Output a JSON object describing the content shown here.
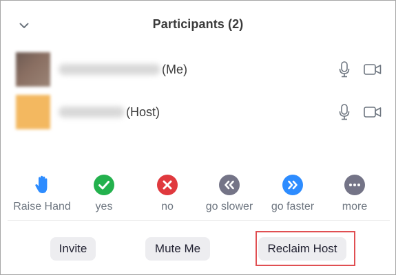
{
  "header": {
    "title": "Participants (2)",
    "collapse_icon": "chevron-down-icon"
  },
  "participants": [
    {
      "role_label": "(Me)",
      "name_hidden": true,
      "mic_icon": "microphone-icon",
      "video_icon": "video-camera-icon"
    },
    {
      "role_label": "(Host)",
      "name_hidden": true,
      "mic_icon": "microphone-icon",
      "video_icon": "video-camera-icon"
    }
  ],
  "reactions": [
    {
      "label": "Raise Hand",
      "icon": "raise-hand-icon",
      "color": "#2d8cff"
    },
    {
      "label": "yes",
      "icon": "checkmark-icon",
      "color": "#23b14d"
    },
    {
      "label": "no",
      "icon": "x-icon",
      "color": "#e0393e"
    },
    {
      "label": "go slower",
      "icon": "rewind-icon",
      "color": "#747487"
    },
    {
      "label": "go faster",
      "icon": "fast-forward-icon",
      "color": "#2d8cff"
    },
    {
      "label": "more",
      "icon": "more-dots-icon",
      "color": "#747487"
    }
  ],
  "footer": {
    "invite_label": "Invite",
    "mute_label": "Mute Me",
    "reclaim_label": "Reclaim Host"
  },
  "colors": {
    "highlight": "#e04f52",
    "button_bg": "#ededf0",
    "text": "#232333",
    "muted_text": "#6e7680"
  }
}
